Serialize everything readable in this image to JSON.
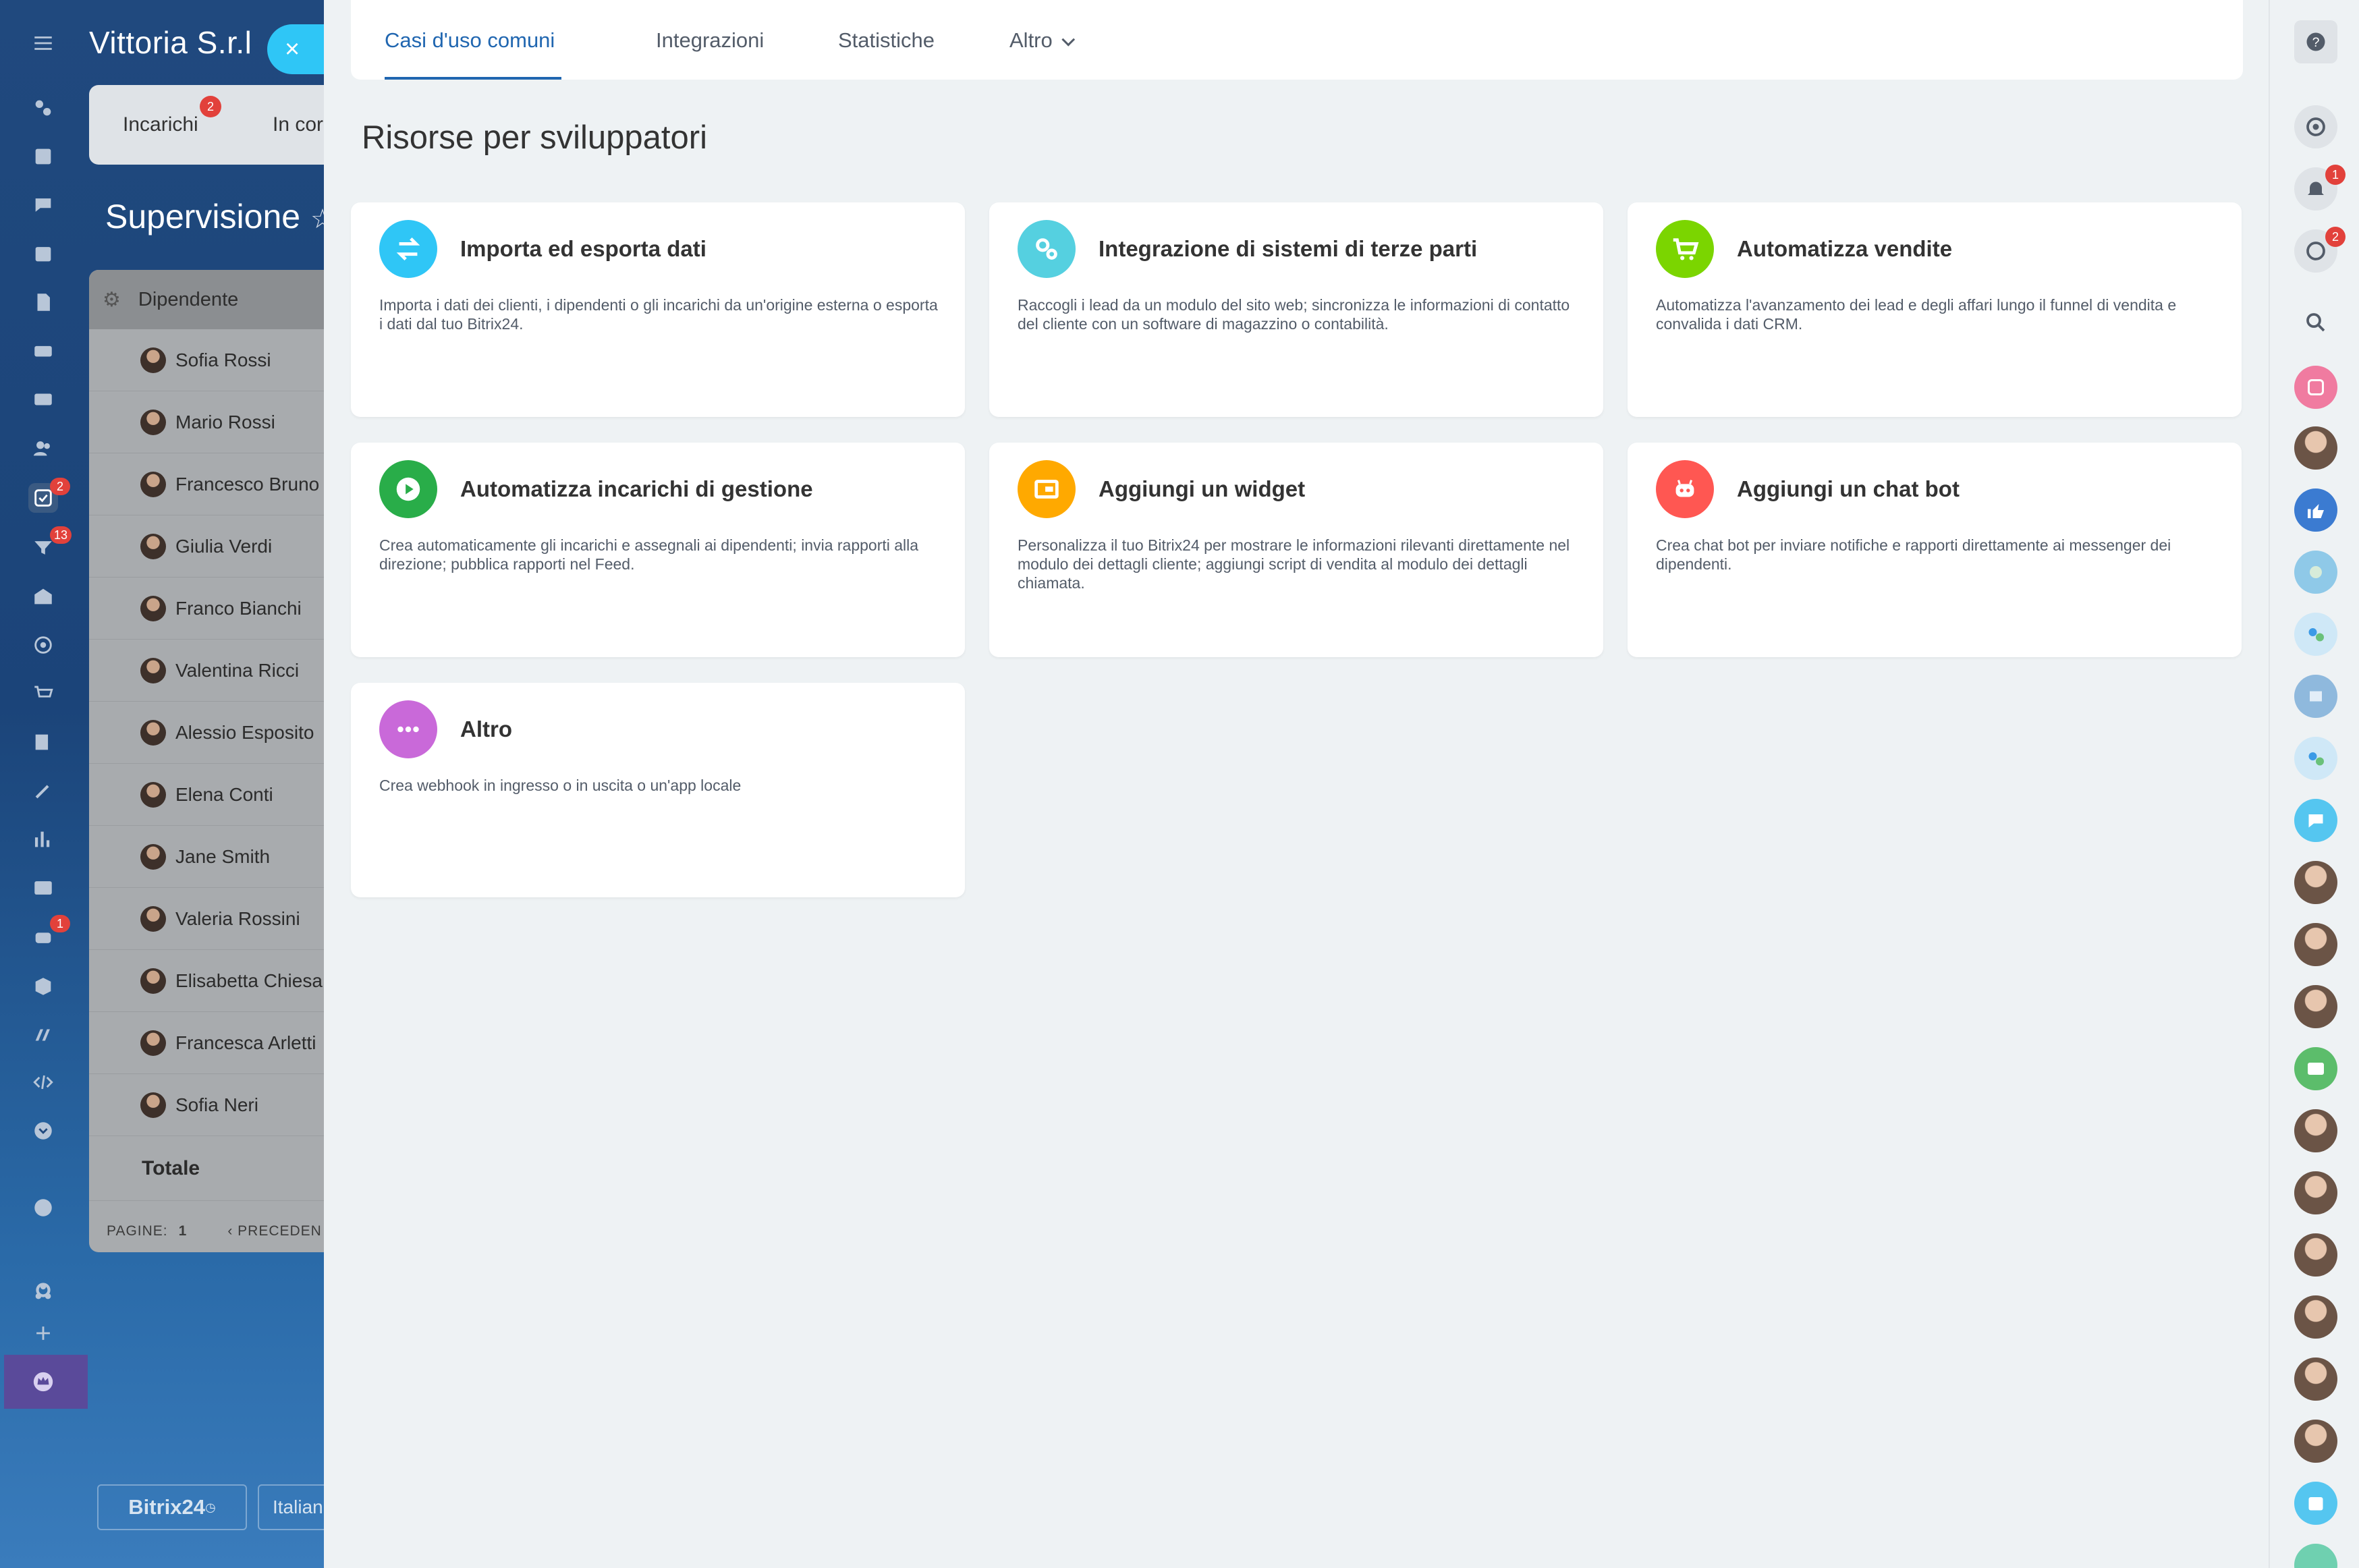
{
  "portal": {
    "company": "Vittoria S.r.l",
    "close_label": "×",
    "tabs": [
      "Incarichi",
      "In cor"
    ],
    "tasks_badge": "2",
    "section_title": "Supervisione",
    "table_header": "Dipendente",
    "employees": [
      "Sofia Rossi",
      "Mario Rossi",
      "Francesco Bruno",
      "Giulia Verdi",
      "Franco Bianchi",
      "Valentina Ricci",
      "Alessio Esposito",
      "Elena Conti",
      "Jane Smith",
      "Valeria Rossini",
      "Elisabetta Chiesa",
      "Francesca Arletti",
      "Sofia Neri"
    ],
    "total_label": "Totale",
    "pages_label": "PAGINE:",
    "pages_value": "1",
    "prev_label": "‹ PRECEDEN",
    "footer_logo": "Bitrix24",
    "footer_lang": "Italian"
  },
  "left_rail": {
    "badges": {
      "tasks": "2",
      "filter": "13",
      "robot": "1"
    }
  },
  "slider": {
    "tabs": [
      {
        "label": "Casi d'uso comuni",
        "active": true
      },
      {
        "label": "Integrazioni",
        "active": false
      },
      {
        "label": "Statistiche",
        "active": false
      },
      {
        "label": "Altro",
        "active": false
      }
    ],
    "title": "Risorse per sviluppatori",
    "cards": [
      {
        "title": "Importa ed esporta dati",
        "desc": "Importa i dati dei clienti, i dipendenti o gli incarichi da un'origine esterna o esporta i dati dal tuo Bitrix24.",
        "color": "#2fc6f6",
        "icon": "arrows-exchange-icon"
      },
      {
        "title": "Integrazione di sistemi di terze parti",
        "desc": "Raccogli i lead da un modulo del sito web; sincronizza le informazioni di contatto del cliente con un software di magazzino o contabilità.",
        "color": "#55d0e0",
        "icon": "gears-icon"
      },
      {
        "title": "Automatizza vendite",
        "desc": "Automatizza l'avanzamento dei lead e degli affari lungo il funnel di vendita e convalida i dati CRM.",
        "color": "#7bd500",
        "icon": "cart-icon"
      },
      {
        "title": "Automatizza incarichi di gestione",
        "desc": "Crea automaticamente gli incarichi e assegnali ai dipendenti; invia rapporti alla direzione; pubblica rapporti nel Feed.",
        "color": "#29ad49",
        "icon": "play-icon"
      },
      {
        "title": "Aggiungi un widget",
        "desc": "Personalizza il tuo Bitrix24 per mostrare le informazioni rilevanti direttamente nel modulo dei dettagli cliente; aggiungi script di vendita al modulo dei dettagli chiamata.",
        "color": "#ffa900",
        "icon": "widget-icon"
      },
      {
        "title": "Aggiungi un chat bot",
        "desc": "Crea chat bot per inviare notifiche e rapporti direttamente ai messenger dei dipendenti.",
        "color": "#ff5752",
        "icon": "robot-icon"
      },
      {
        "title": "Altro",
        "desc": "Crea webhook in ingresso o in uscita o un'app locale",
        "color": "#c969d9",
        "icon": "dots-icon"
      }
    ]
  },
  "right_rail": {
    "badges": {
      "notifications": "1",
      "messages": "2"
    }
  }
}
